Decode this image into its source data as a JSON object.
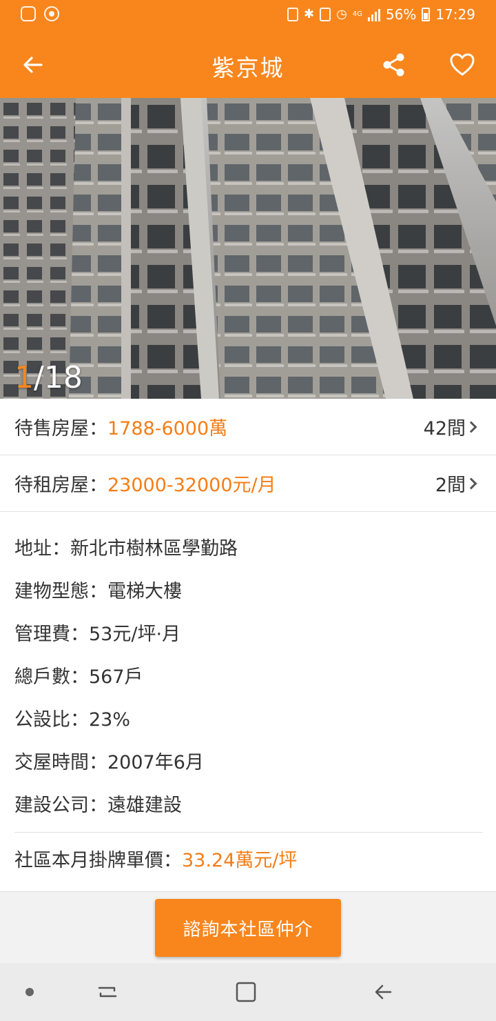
{
  "status_bar": {
    "battery": "56%",
    "time": "17:29",
    "network": "4G"
  },
  "header": {
    "title": "紫京城"
  },
  "gallery": {
    "current": "1",
    "total": "/18"
  },
  "sale": {
    "label": "待售房屋",
    "colon": "：",
    "value": "1788-6000萬",
    "count": "42間"
  },
  "rent": {
    "label": "待租房屋",
    "colon": "：",
    "value": "23000-32000元/月",
    "count": "2間"
  },
  "details": [
    "地址：新北市樹林區學勤路",
    "建物型態：電梯大樓",
    "管理費：53元/坪·月",
    "總戶數：567戶",
    "公設比：23%",
    "交屋時間：2007年6月",
    "建設公司：遠雄建設"
  ],
  "average_price": {
    "label": "社區本月掛牌單價：",
    "value": "33.24萬元/坪"
  },
  "action": {
    "consult_label": "諮詢本社區仲介"
  },
  "colors": {
    "accent": "#f8861d",
    "price_text": "#f47d17"
  },
  "icons": [
    "back-arrow-icon",
    "share-icon",
    "heart-icon",
    "chevron-right-icon",
    "recent-apps-icon",
    "home-icon",
    "nav-back-icon"
  ]
}
